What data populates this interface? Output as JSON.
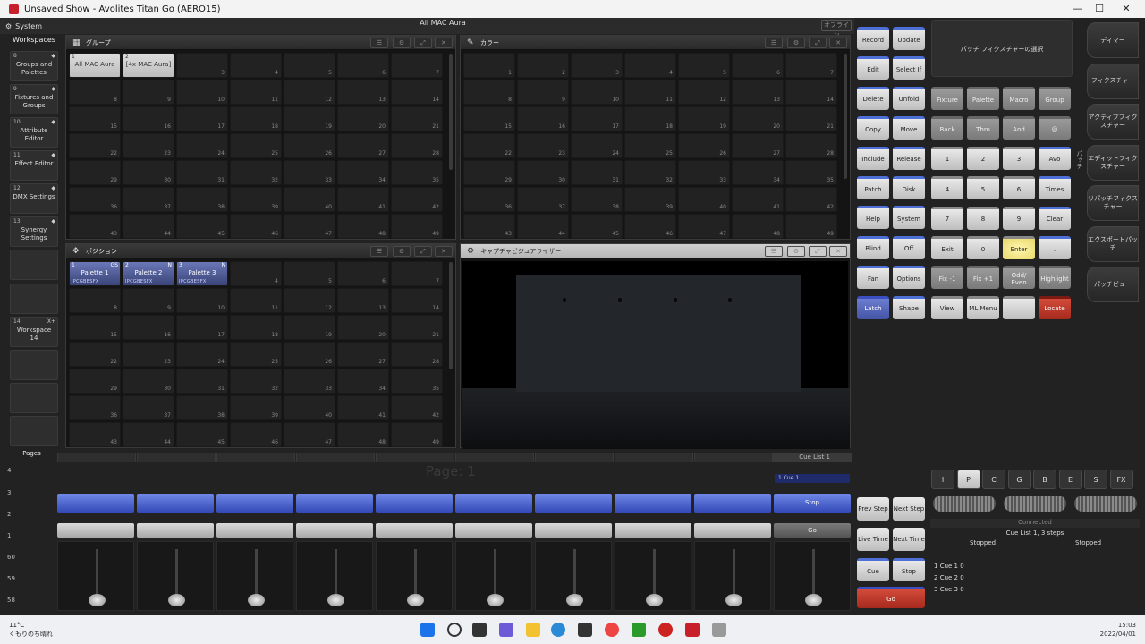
{
  "window": {
    "title": "Unsaved Show - Avolites Titan Go (AERO15)"
  },
  "topbar": {
    "system_label": "System",
    "show_title": "All MAC Aura",
    "offline": "オフライン"
  },
  "workspaces": {
    "header": "Workspaces",
    "items": [
      {
        "num": "8",
        "label": "Groups and Palettes"
      },
      {
        "num": "9",
        "label": "Fixtures and Groups"
      },
      {
        "num": "10",
        "label": "Attribute Editor"
      },
      {
        "num": "11",
        "label": "Effect Editor"
      },
      {
        "num": "12",
        "label": "DMX Settings"
      },
      {
        "num": "13",
        "label": "Synergy Settings"
      },
      {
        "num": "14",
        "label": "Workspace 14",
        "corner": "X+"
      }
    ]
  },
  "panels": {
    "groups": {
      "title": "グループ",
      "items": [
        {
          "num": "1",
          "label": "All MAC Aura"
        },
        {
          "num": "2",
          "label": "[4x MAC Aura]"
        }
      ]
    },
    "color": {
      "title": "カラー"
    },
    "position": {
      "title": "ポジション",
      "items": [
        {
          "num": "1",
          "flag": "GS",
          "label": "Palette 1",
          "attrs": "IPCGBESFX"
        },
        {
          "num": "2",
          "flag": "N",
          "label": "Palette 2",
          "attrs": "IPCGBESFX"
        },
        {
          "num": "3",
          "flag": "N",
          "label": "Palette 3",
          "attrs": "IPCGBESFX"
        }
      ]
    },
    "visualiser": {
      "title": "キャプチャビジュアライザー"
    }
  },
  "programmer": {
    "select_label": "パッチ フィクスチャーの選択",
    "left_buttons": [
      [
        "Record",
        "Update"
      ],
      [
        "Edit",
        "Select If"
      ],
      [
        "Delete",
        "Unfold"
      ],
      [
        "Copy",
        "Move"
      ],
      [
        "Include",
        "Release"
      ],
      [
        "Patch",
        "Disk"
      ],
      [
        "Help",
        "System"
      ],
      [
        "Blind",
        "Off"
      ],
      [
        "Fan",
        "Options"
      ],
      [
        "Latch",
        "Shape"
      ]
    ],
    "keypad": [
      [
        "Fixture",
        "Palette",
        "Macro",
        "Group"
      ],
      [
        "Back",
        "Thro",
        "And",
        "@"
      ],
      [
        "1",
        "2",
        "3",
        "Avo"
      ],
      [
        "4",
        "5",
        "6",
        "Times"
      ],
      [
        "7",
        "8",
        "9",
        "Clear"
      ],
      [
        "Exit",
        "0",
        "Enter",
        "."
      ],
      [
        "Fix -1",
        "Fix +1",
        "Odd/ Even",
        "Highlight"
      ],
      [
        "View",
        "ML Menu",
        "",
        "Locate"
      ]
    ]
  },
  "right_tabs": [
    "ディマー",
    "フィクスチャー",
    "アクティブフィクスチャー",
    "エディットフィクスチャー",
    "リパッチフィクスチャー",
    "エクスポートパッチ",
    "パッチビュー"
  ],
  "sidebar_label": "パッチ",
  "playback": {
    "pages_label": "Pages",
    "page_numbers": [
      "4",
      "3",
      "2",
      "1",
      "60",
      "59",
      "58"
    ],
    "page_text": "Page: 1",
    "cue_list_label": "Cue List 1",
    "cue_mini": "1 Cue 1",
    "stop_label": "Stop",
    "go_label": "Go",
    "fader_count": 10,
    "controls": {
      "prev_step": "Prev Step",
      "next_step": "Next Step",
      "live_time": "Live Time",
      "next_time": "Next Time",
      "cue": "Cue",
      "stop": "Stop",
      "go": "Go"
    }
  },
  "attributes": [
    "I",
    "P",
    "C",
    "G",
    "B",
    "E",
    "S",
    "FX"
  ],
  "attribute_selected": "P",
  "status": {
    "connected": "Connected",
    "cue_list": "Cue List 1, 3 steps",
    "left_state": "Stopped",
    "right_state": "Stopped"
  },
  "cues": [
    {
      "n": "1",
      "name": "Cue 1",
      "v": "0"
    },
    {
      "n": "2",
      "name": "Cue 2",
      "v": "0"
    },
    {
      "n": "3",
      "name": "Cue 3",
      "v": "0"
    }
  ],
  "taskbar": {
    "temp": "11°C",
    "weather": "くもりのち晴れ",
    "time": "15:03",
    "date": "2022/04/01"
  }
}
